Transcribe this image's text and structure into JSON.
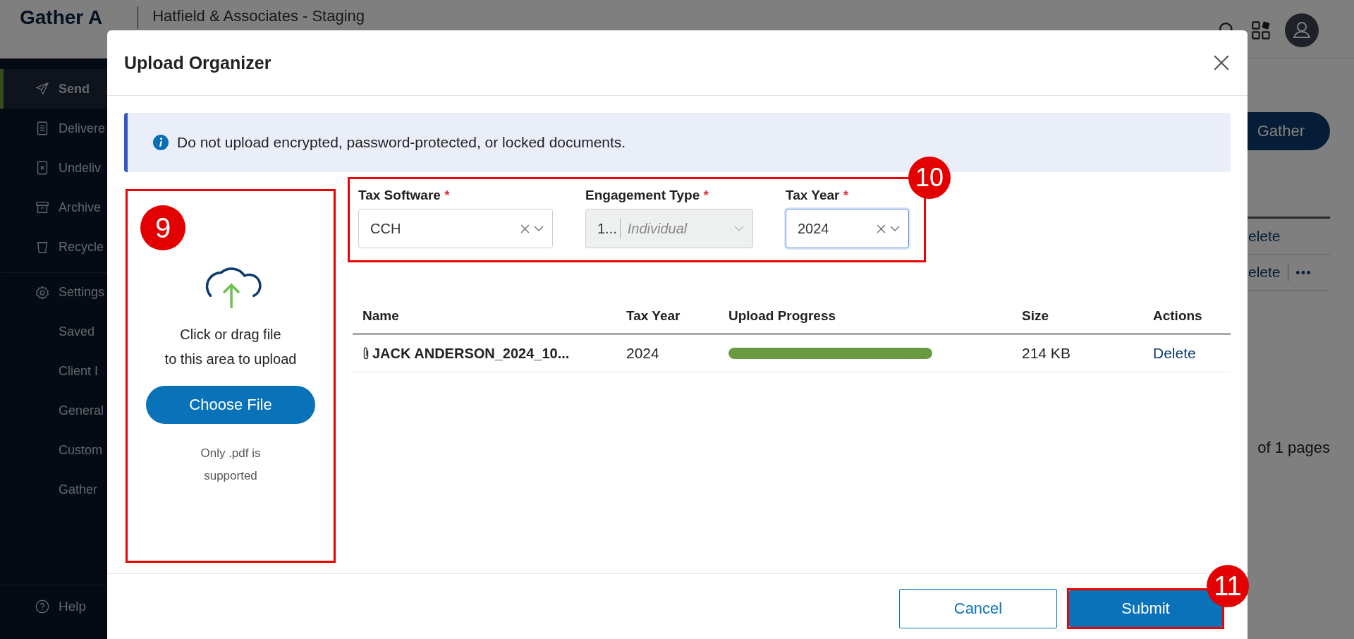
{
  "app_header": {
    "logo": "Gather A",
    "org": "Hatfield & Associates - Staging"
  },
  "sidebar": {
    "items": [
      {
        "label": "Send",
        "kind": "main",
        "selected": true
      },
      {
        "label": "Delivere",
        "kind": "main",
        "selected": false
      },
      {
        "label": "Undeliv",
        "kind": "main",
        "selected": false
      },
      {
        "label": "Archive",
        "kind": "main",
        "selected": false
      },
      {
        "label": "Recycle",
        "kind": "main",
        "selected": false
      },
      {
        "label": "Settings",
        "kind": "section",
        "selected": false
      },
      {
        "label": "Saved",
        "kind": "sub",
        "selected": false
      },
      {
        "label": "Client I",
        "kind": "sub",
        "selected": false
      },
      {
        "label": "General",
        "kind": "sub",
        "selected": false
      },
      {
        "label": "Custom",
        "kind": "sub",
        "selected": false
      },
      {
        "label": "Gather",
        "kind": "sub",
        "selected": false
      }
    ],
    "help": "Help"
  },
  "background": {
    "gather_button": "Gather",
    "rows": [
      {
        "action": "elete",
        "more": false
      },
      {
        "action": "elete",
        "more": true
      }
    ],
    "pagination": "of 1  pages"
  },
  "modal": {
    "title": "Upload Organizer",
    "notice": "Do not upload encrypted, password-protected, or locked documents.",
    "upload": {
      "prompt": [
        "Click or drag file",
        "to this area to upload"
      ],
      "button": "Choose File",
      "hint": "Only .pdf is supported"
    },
    "fields": [
      {
        "label": "Tax Software",
        "required_mark": "*",
        "value": "CCH",
        "clearable": true,
        "disabled": false,
        "focused": false
      },
      {
        "label": "Engagement Type",
        "required_mark": "*",
        "code": "1...",
        "value": "Individual",
        "clearable": false,
        "disabled": true,
        "focused": false
      },
      {
        "label": "Tax Year",
        "required_mark": "*",
        "value": "2024",
        "clearable": true,
        "disabled": false,
        "focused": true
      }
    ],
    "table": {
      "columns": [
        "Name",
        "Tax Year",
        "Upload Progress",
        "Size",
        "Actions"
      ],
      "rows": [
        {
          "name": "JACK ANDERSON_2024_10...",
          "tax_year": "2024",
          "level": 1,
          "size": "214 KB",
          "action": "Delete"
        }
      ]
    },
    "buttons": [
      {
        "label": "Cancel",
        "kind": "secondary"
      },
      {
        "label": "Submit",
        "kind": "primary"
      }
    ]
  },
  "annotations": [
    {
      "label": "9"
    },
    {
      "label": "10"
    },
    {
      "label": "11"
    }
  ]
}
